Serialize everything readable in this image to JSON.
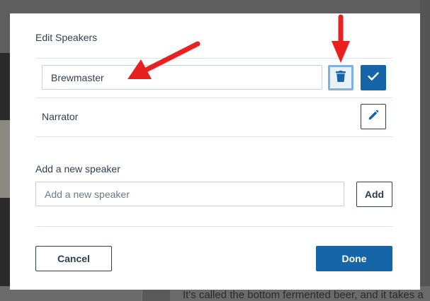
{
  "background": {
    "text": "It's called the bottom fermented beer, and it takes a"
  },
  "modal": {
    "title": "Edit Speakers",
    "speakers": [
      {
        "value": "Brewmaster",
        "editing": true
      },
      {
        "label": "Narrator",
        "editing": false
      }
    ],
    "add_section": {
      "label": "Add a new speaker",
      "placeholder": "Add a new speaker",
      "value": "",
      "add_label": "Add"
    },
    "cancel_label": "Cancel",
    "done_label": "Done"
  },
  "icons": {
    "delete": "trash-icon",
    "confirm": "check-icon",
    "edit": "pencil-icon"
  },
  "colors": {
    "primary": "#1565a8",
    "annotation_arrow": "#e8201f",
    "text": "#2e3f51"
  }
}
